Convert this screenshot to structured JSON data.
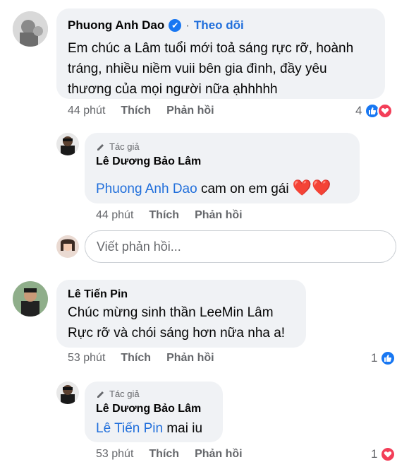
{
  "comments": [
    {
      "author": "Phuong Anh Dao",
      "follow_label": "Theo dõi",
      "text_lines": [
        "Em chúc a Lâm tuổi mới toả sáng rực rỡ, hoành",
        "tráng, nhiều niềm vuii bên gia đình, đầy yêu",
        "thương của mọi người nữa ạhhhhh"
      ],
      "time": "44 phút",
      "like_label": "Thích",
      "reply_label": "Phản hồi",
      "reaction_count": "4",
      "reply": {
        "badge": "Tác giả",
        "author": "Lê Dương Bảo Lâm",
        "mention": "Phuong Anh Dao",
        "text": " cam on em gái ",
        "time": "44 phút",
        "like_label": "Thích",
        "reply_label": "Phản hồi"
      },
      "reply_input_placeholder": "Viết phản hồi..."
    },
    {
      "author": "Lê Tiến Pin",
      "text_lines": [
        "Chúc mừng sinh thần LeeMin Lâm",
        "Rực rỡ và chói sáng hơn nữa nha a!"
      ],
      "time": "53 phút",
      "like_label": "Thích",
      "reply_label": "Phản hồi",
      "reaction_count": "1",
      "reply": {
        "badge": "Tác giả",
        "author": "Lê Dương Bảo Lâm",
        "mention": "Lê Tiến Pin",
        "text": " mai iu",
        "time": "53 phút",
        "like_label": "Thích",
        "reply_label": "Phản hồi",
        "reaction_count": "1"
      }
    }
  ],
  "colors": {
    "link": "#216fdb",
    "bubble": "#f0f2f5",
    "meta": "#65676b",
    "like": "#1877f2",
    "love": "#f33e58"
  }
}
